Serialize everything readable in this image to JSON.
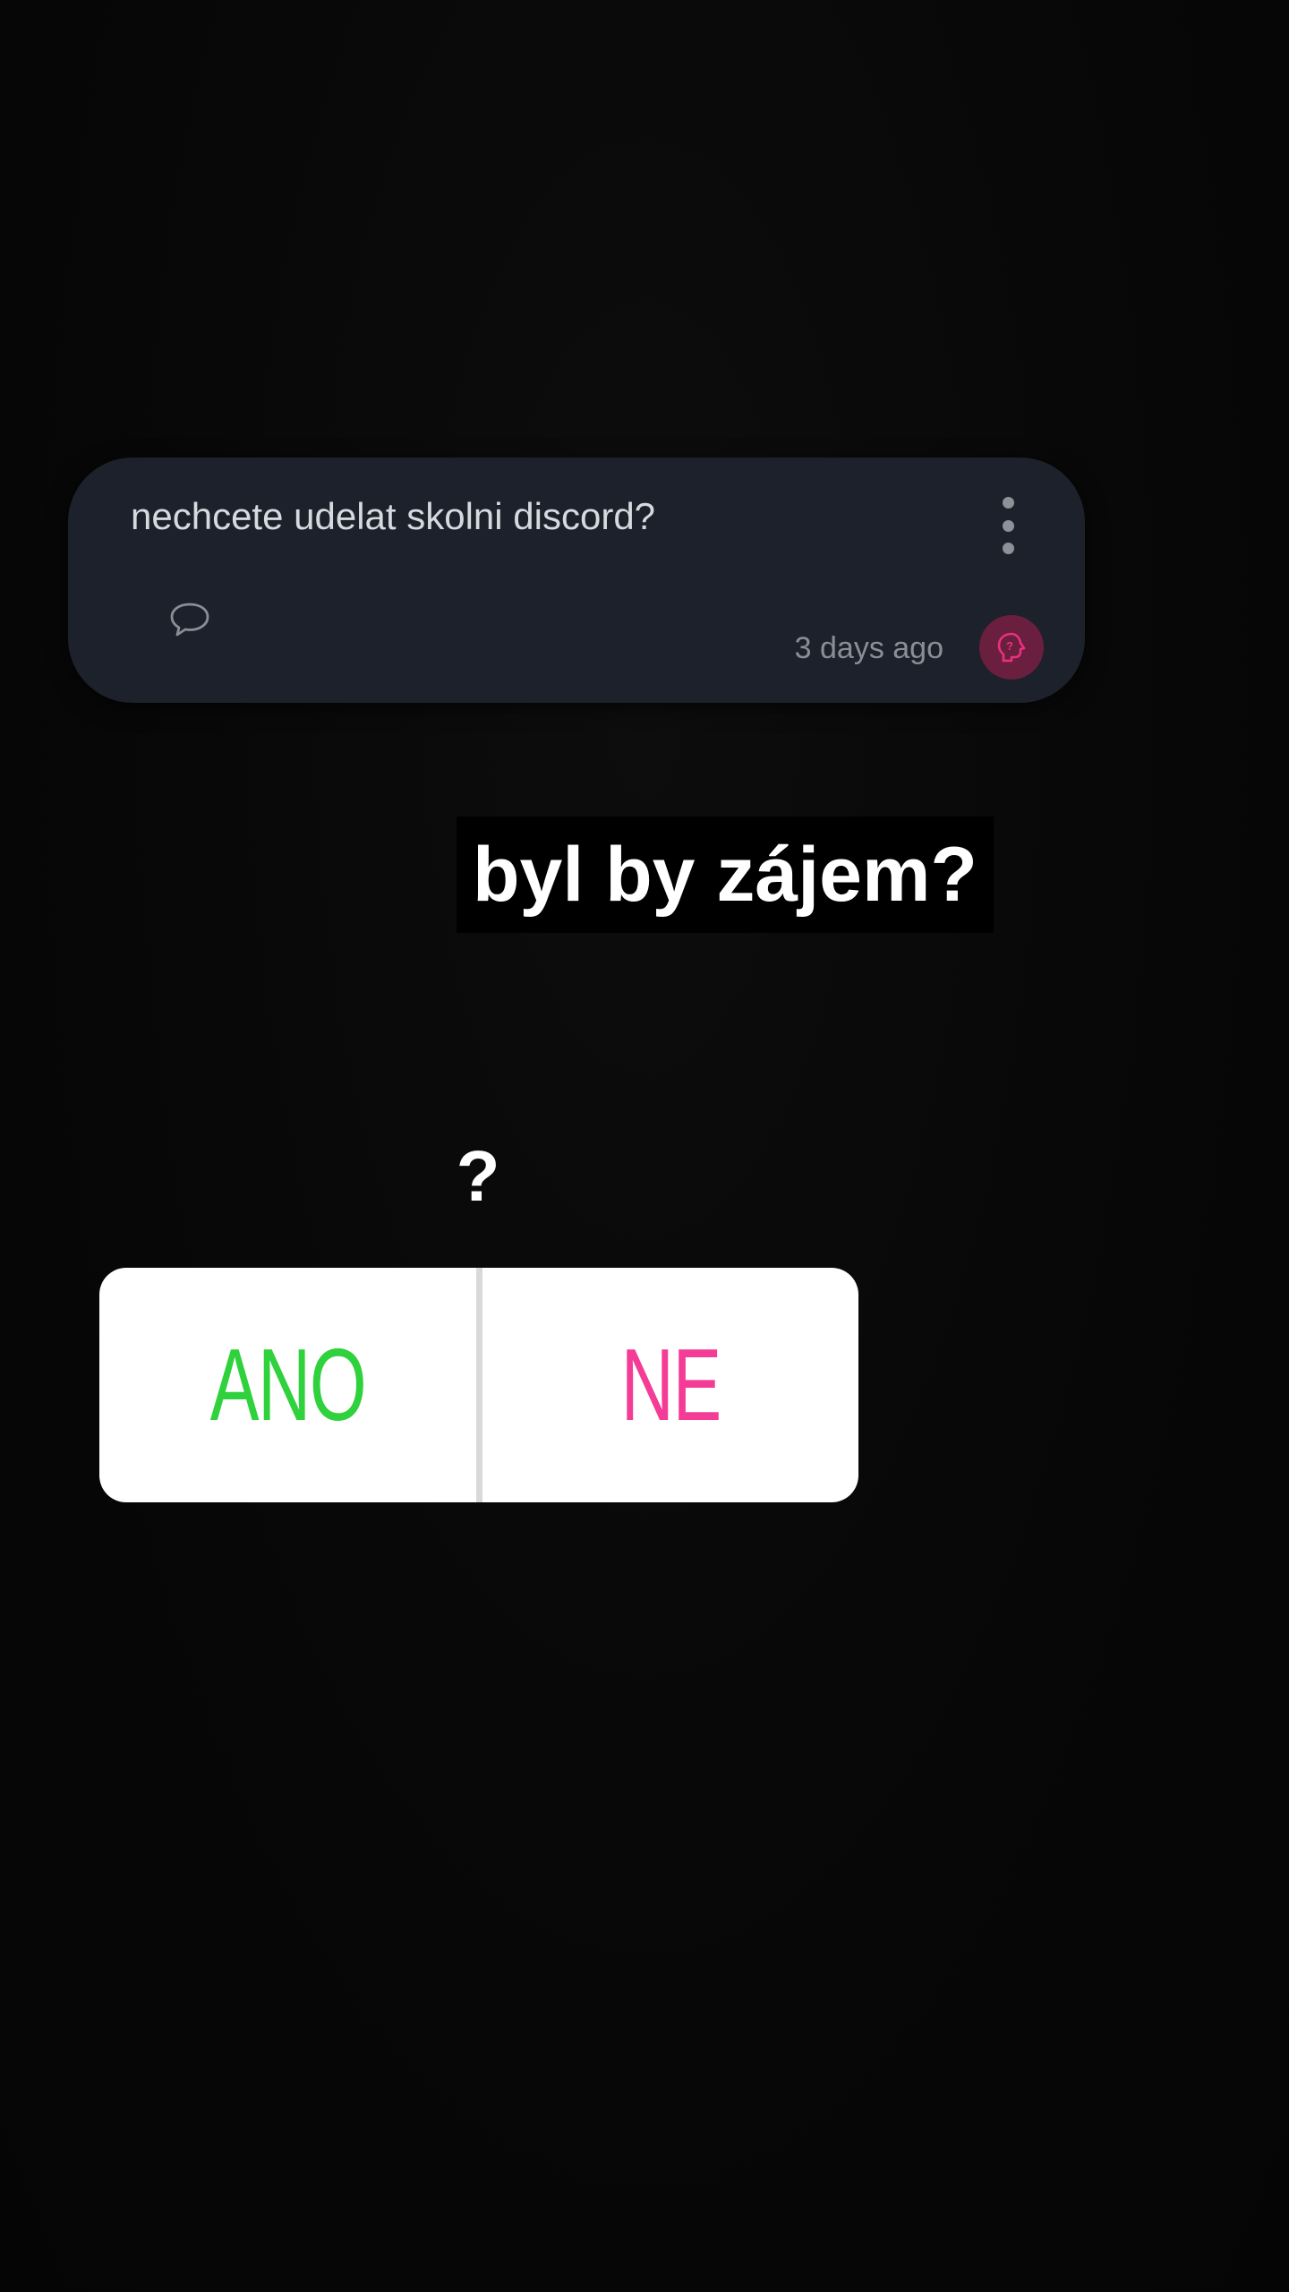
{
  "question_card": {
    "text": "nechcete udelat skolni discord?",
    "timestamp": "3 days ago",
    "comment_icon": "speech-bubble-icon",
    "menu_icon": "more-vertical-icon",
    "badge_icon": "question-head-icon",
    "badge_color": "#e8317f"
  },
  "headline": {
    "text": "byl by zájem?"
  },
  "poll": {
    "question": "?",
    "options": [
      {
        "label": "ANO",
        "color": "#2fd13d"
      },
      {
        "label": "NE",
        "color": "#f43c96"
      }
    ]
  }
}
